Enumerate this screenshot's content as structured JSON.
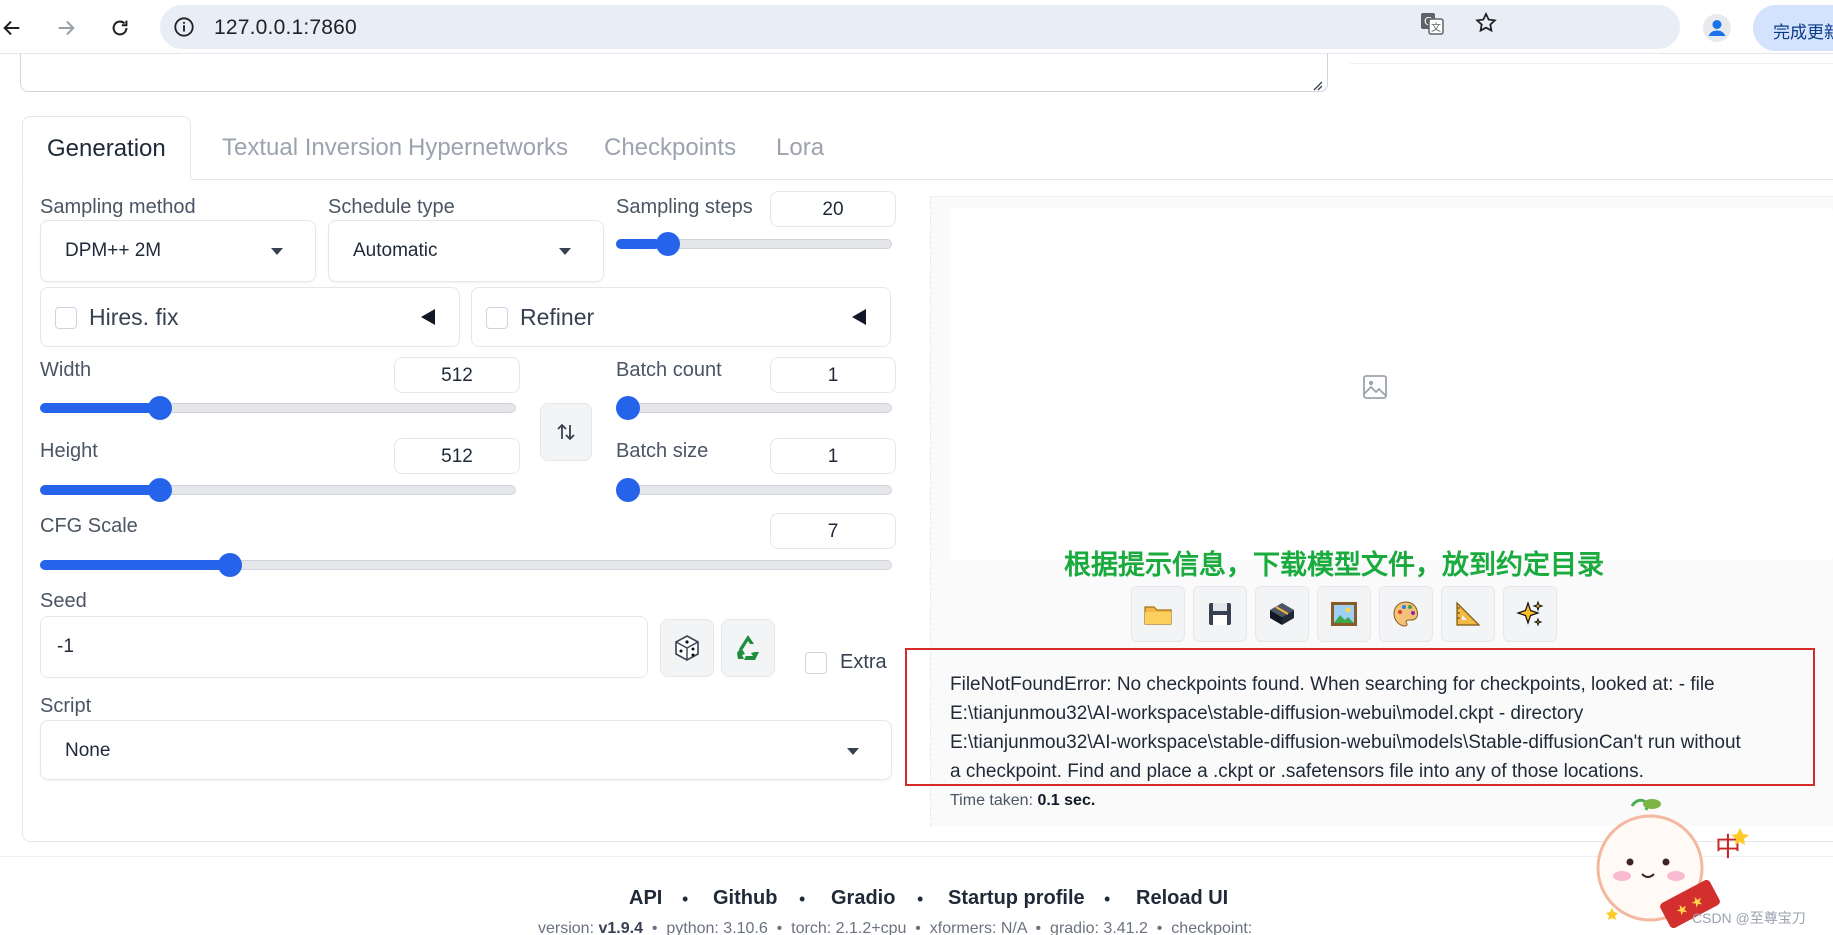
{
  "browser": {
    "url": "127.0.0.1:7860",
    "update_label": "完成更新"
  },
  "tabs": [
    {
      "label": "Generation"
    },
    {
      "label": "Textual Inversion"
    },
    {
      "label": "Hypernetworks"
    },
    {
      "label": "Checkpoints"
    },
    {
      "label": "Lora"
    }
  ],
  "settings": {
    "sampling_method": {
      "label": "Sampling method",
      "value": "DPM++ 2M"
    },
    "schedule_type": {
      "label": "Schedule type",
      "value": "Automatic"
    },
    "sampling_steps": {
      "label": "Sampling steps",
      "value": "20",
      "fraction": 0.16
    },
    "hires_fix": {
      "label": "Hires. fix"
    },
    "refiner": {
      "label": "Refiner"
    },
    "width": {
      "label": "Width",
      "value": "512",
      "fraction": 0.24
    },
    "height": {
      "label": "Height",
      "value": "512",
      "fraction": 0.24
    },
    "batch_count": {
      "label": "Batch count",
      "value": "1",
      "fraction": 0.0
    },
    "batch_size": {
      "label": "Batch size",
      "value": "1",
      "fraction": 0.0
    },
    "cfg_scale": {
      "label": "CFG Scale",
      "value": "7",
      "fraction": 0.215
    },
    "seed": {
      "label": "Seed",
      "value": "-1"
    },
    "extra": {
      "label": "Extra"
    },
    "script": {
      "label": "Script",
      "value": "None"
    }
  },
  "output": {
    "annotation": "根据提示信息，下载模型文件，放到约定目录",
    "error_lines": [
      "FileNotFoundError: No checkpoints found. When searching for checkpoints, looked at: - file",
      "E:\\tianjunmou32\\AI-workspace\\stable-diffusion-webui\\model.ckpt - directory",
      "E:\\tianjunmou32\\AI-workspace\\stable-diffusion-webui\\models\\Stable-diffusionCan't run without",
      "a checkpoint. Find and place a .ckpt or .safetensors file into any of those locations."
    ],
    "time_label": "Time taken:",
    "time_value": "0.1 sec.",
    "tool_icons": [
      "folder-icon",
      "save-icon",
      "zip-icon",
      "image-icon",
      "palette-icon",
      "ruler-icon",
      "sparkle-icon"
    ]
  },
  "footer": {
    "links": [
      "API",
      "Github",
      "Gradio",
      "Startup profile",
      "Reload UI"
    ],
    "sep": "•",
    "version": {
      "version_label": "version:",
      "version_value": "v1.9.4",
      "python": "python: 3.10.6",
      "torch": "torch: 2.1.2+cpu",
      "xformers": "xformers: N/A",
      "gradio": "gradio: 3.41.2",
      "checkpoint": "checkpoint:"
    }
  },
  "watermark": {
    "text": "CSDN @至尊宝刀",
    "sticker_char": "中"
  },
  "colors": {
    "accent": "#2563eb",
    "annotation": "#1aab3e",
    "error_border": "#d62b2b"
  }
}
